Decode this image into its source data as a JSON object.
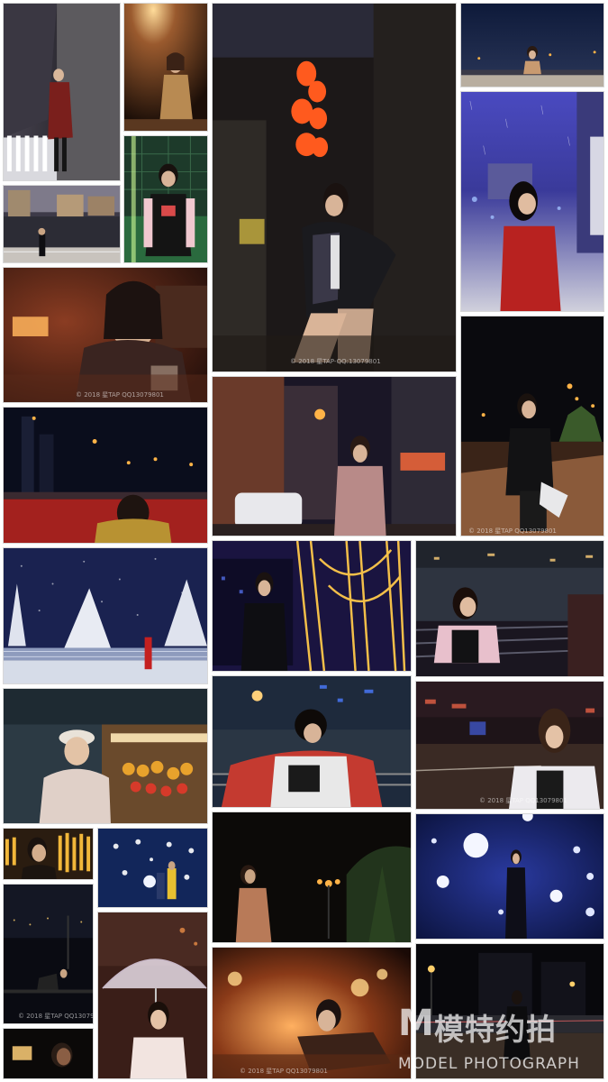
{
  "captions": {
    "c1": "© 2018 星TAP-QQ:13079801",
    "c2": "© 2018 星TAP QQ13079801",
    "c3": "© 2018 星TAP QQ13079801",
    "c4": "© 2018 星TAP QQ13079801",
    "c5": "© 2018 星TAP QQ13079801",
    "c6": "© 2018 星TAP QQ13079801"
  },
  "watermark": {
    "logo": "M",
    "cn": "模特约拍",
    "en": "MODEL PHOTOGRAPH"
  },
  "colors": {
    "background": "#ffffff",
    "night_sky": "#0c1230",
    "lantern": "#ff5a1e",
    "street_light": "#ffb347"
  }
}
